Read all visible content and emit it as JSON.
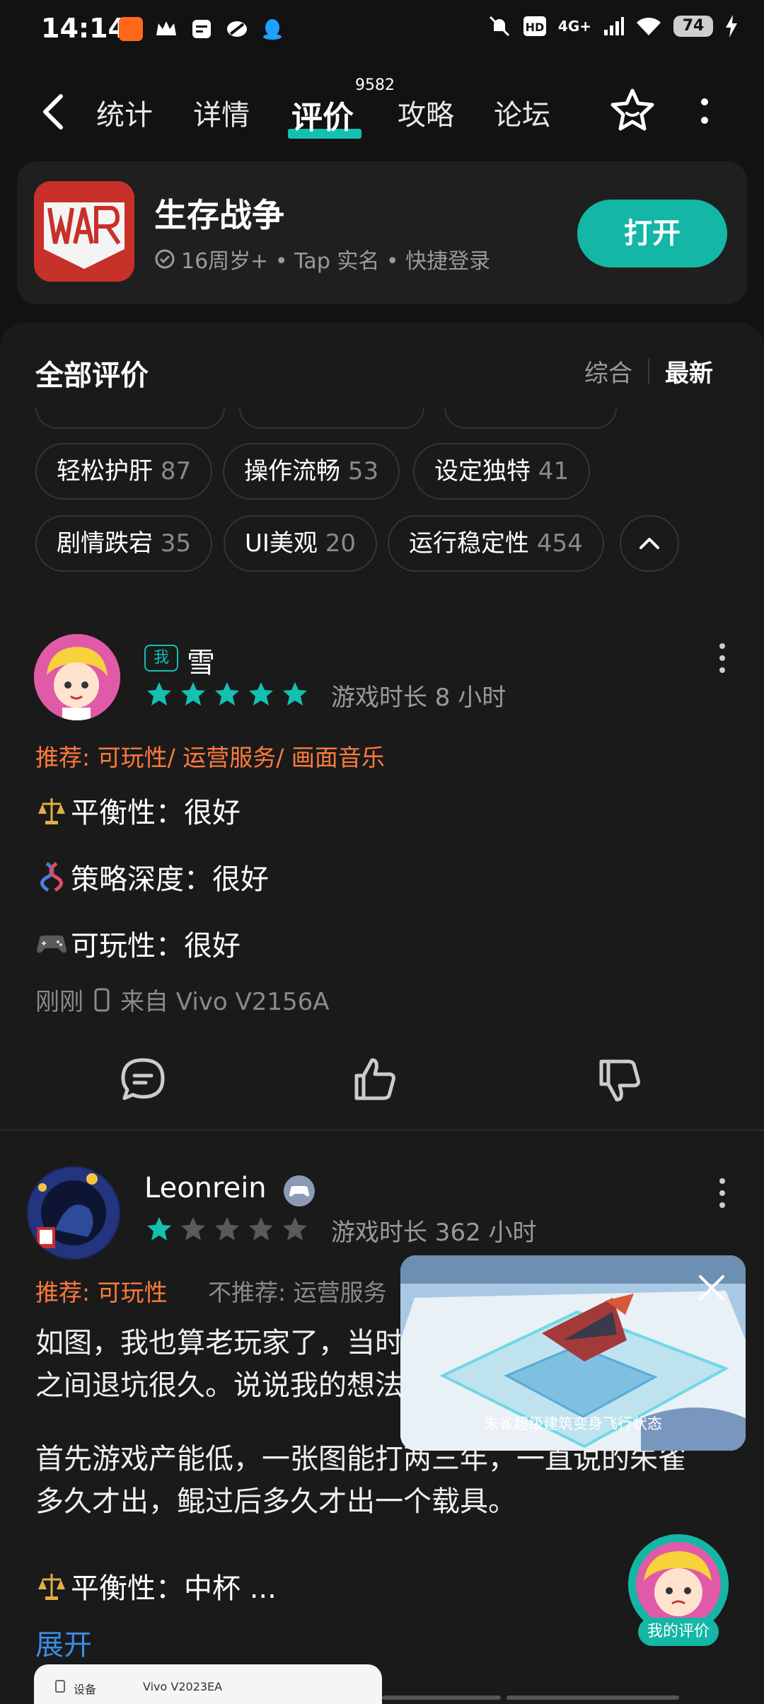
{
  "status_bar": {
    "time": "14:14",
    "network": "4G+",
    "battery": "74"
  },
  "nav": {
    "tabs": [
      {
        "label": "统计"
      },
      {
        "label": "详情"
      },
      {
        "label": "评价"
      },
      {
        "label": "攻略"
      },
      {
        "label": "论坛"
      }
    ],
    "review_count_badge": "9582"
  },
  "game": {
    "name": "生存战争",
    "meta": "16周岁+ • Tap 实名 • 快捷登录",
    "open_label": "打开"
  },
  "reviews_panel": {
    "title": "全部评价",
    "sort_options": [
      "综合",
      "最新"
    ],
    "tags": [
      {
        "label": "轻松护肝",
        "count": "87"
      },
      {
        "label": "操作流畅",
        "count": "53"
      },
      {
        "label": "设定独特",
        "count": "41"
      },
      {
        "label": "剧情跌宕",
        "count": "35"
      },
      {
        "label": "UI美观",
        "count": "20"
      },
      {
        "label": "运行稳定性",
        "count": "454"
      }
    ]
  },
  "review1": {
    "me_badge": "我",
    "name": "雪",
    "stars": 5,
    "playtime": "游戏时长 8 小时",
    "recommend": "推荐: 可玩性/ 运营服务/ 画面音乐",
    "items": [
      "平衡性：很好",
      "策略深度：很好",
      "可玩性：很好"
    ],
    "time": "刚刚",
    "device": "来自 Vivo V2156A"
  },
  "review2": {
    "name": "Leonrein",
    "stars": 1,
    "playtime": "游戏时长 362 小时",
    "recommend": "推荐: 可玩性",
    "not_recommend": "不推荐: 运营服务",
    "para1_line1": "如图，我也算老玩家了，当时",
    "para1_line2": "之间退坑很久。说说我的想法",
    "para2_line1": "首先游戏产能低，一张图能打两三年，一直说的朱雀",
    "para2_line2": "多久才出，鲲过后多久才出一个载具。",
    "item": "平衡性：中杯 ...",
    "expand_label": "展开",
    "thumb_label": "设备",
    "thumb_value": "Vivo V2023EA"
  },
  "video": {
    "caption": "朱雀超级建筑变身飞行状态"
  },
  "fab": {
    "label": "我的评价"
  },
  "colors": {
    "accent": "#14b6a6",
    "recommend": "#ff7a3d",
    "link": "#3a8ee6",
    "star_on": "#14c0b0",
    "star_off": "#5a5a5a"
  }
}
